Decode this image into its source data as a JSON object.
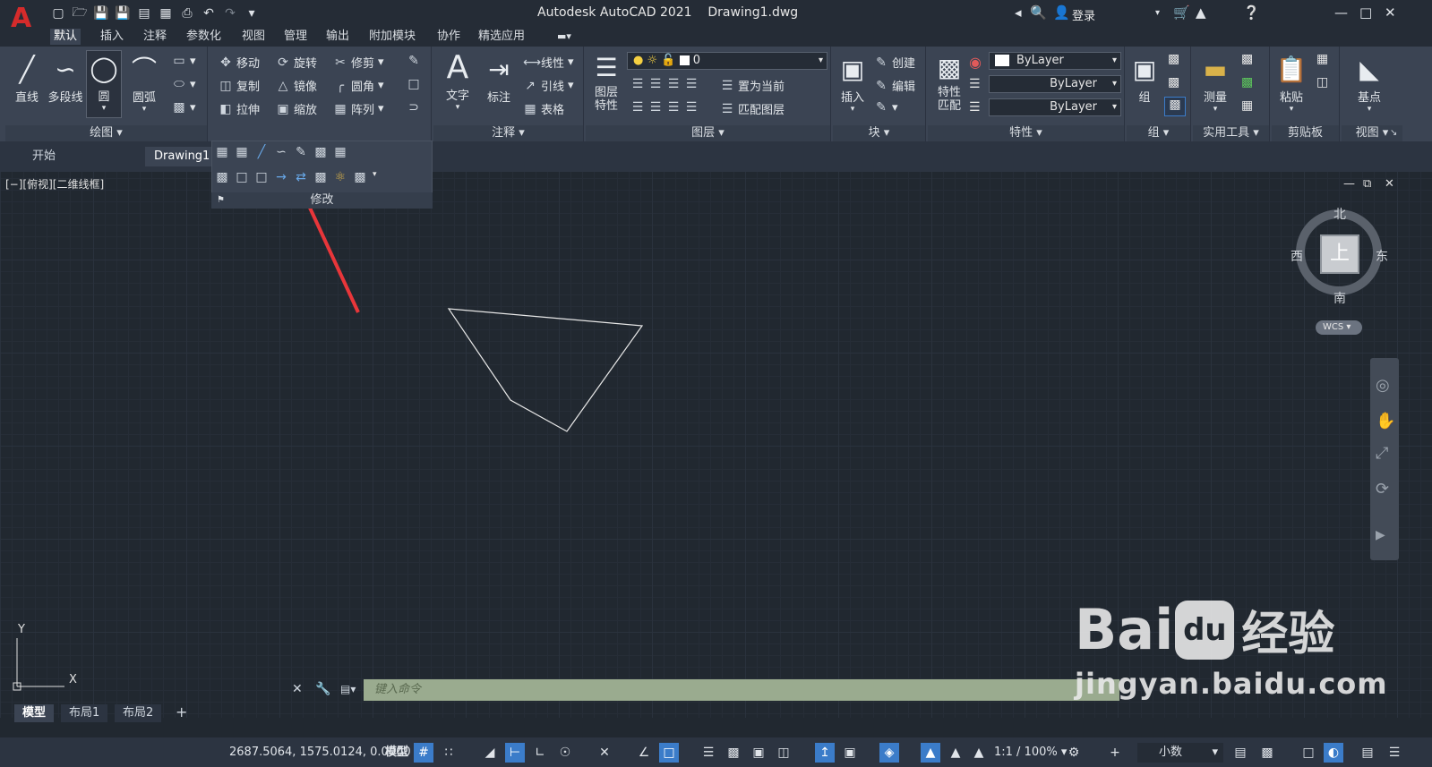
{
  "app": {
    "title": "Autodesk AutoCAD 2021",
    "filename": "Drawing1.dwg",
    "logo": "A",
    "login": "登录"
  },
  "main_tabs": [
    "默认",
    "插入",
    "注释",
    "参数化",
    "视图",
    "管理",
    "输出",
    "附加模块",
    "协作",
    "精选应用"
  ],
  "ribbon": {
    "draw": {
      "label": "绘图",
      "line": "直线",
      "polyline": "多段线",
      "circle": "圆",
      "arc": "圆弧"
    },
    "modify": {
      "move": "移动",
      "rotate": "旋转",
      "trim": "修剪",
      "copy": "复制",
      "mirror": "镜像",
      "fillet": "圆角",
      "stretch": "拉伸",
      "scale": "缩放",
      "array": "阵列"
    },
    "annotation": {
      "label": "注释",
      "text": "文字",
      "dimension": "标注",
      "linear": "线性",
      "leader": "引线",
      "table": "表格"
    },
    "layers": {
      "label": "图层",
      "layer_props": "图层\n特性",
      "current_layer": "0",
      "set_current": "置为当前",
      "match_layer": "匹配图层"
    },
    "block": {
      "label": "块",
      "insert": "插入",
      "create": "创建",
      "edit": "编辑"
    },
    "properties": {
      "label": "特性",
      "match": "特性\n匹配",
      "color": "ByLayer",
      "linetype": "ByLayer",
      "lineweight": "ByLayer"
    },
    "groups": {
      "label": "组",
      "group": "组"
    },
    "utilities": {
      "label": "实用工具",
      "measure": "测量"
    },
    "clipboard": {
      "label": "剪贴板",
      "paste": "粘贴"
    },
    "view": {
      "label": "视图",
      "base": "基点"
    }
  },
  "flyout": {
    "label": "修改"
  },
  "doc_tabs": [
    "开始",
    "Drawing1"
  ],
  "viewport": {
    "label": "[−][俯视][二维线框]",
    "compass": {
      "north": "北",
      "south": "南",
      "east": "东",
      "west": "西"
    },
    "cube_face": "上",
    "wcs": "WCS",
    "ucs": {
      "x": "X",
      "y": "Y"
    }
  },
  "polygon": [
    [
      501,
      345
    ],
    [
      717,
      364
    ],
    [
      633,
      482
    ],
    [
      570,
      447
    ]
  ],
  "command": {
    "placeholder": "键入命令"
  },
  "layout_tabs": [
    "模型",
    "布局1",
    "布局2"
  ],
  "status": {
    "coords": "2687.5064, 1575.0124, 0.0000",
    "model": "模型",
    "scale": "1:1 / 100%",
    "units": "小数"
  },
  "watermark": {
    "brand": "Bai",
    "du": "du",
    "cn": "经验",
    "url": "jingyan.baidu.com"
  },
  "colors": {
    "accent": "#3b7cc9",
    "logo": "#d52b2b",
    "arrow": "#e8363a"
  }
}
